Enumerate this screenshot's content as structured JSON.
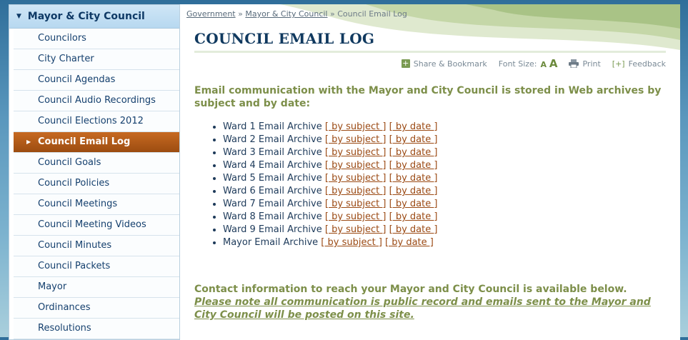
{
  "sidebar": {
    "heading": "Mayor & City Council",
    "items": [
      {
        "label": "Councilors"
      },
      {
        "label": "City Charter"
      },
      {
        "label": "Council Agendas"
      },
      {
        "label": "Council Audio Recordings"
      },
      {
        "label": "Council Elections 2012"
      },
      {
        "label": "Council Email Log",
        "active": true
      },
      {
        "label": "Council Goals"
      },
      {
        "label": "Council Policies"
      },
      {
        "label": "Council Meetings"
      },
      {
        "label": "Council Meeting Videos"
      },
      {
        "label": "Council Minutes"
      },
      {
        "label": "Council Packets"
      },
      {
        "label": "Mayor"
      },
      {
        "label": "Ordinances"
      },
      {
        "label": "Resolutions"
      }
    ]
  },
  "breadcrumb": {
    "items": [
      "Government",
      "Mayor & City Council"
    ],
    "separator": "»",
    "current": "Council Email Log"
  },
  "page": {
    "title": "COUNCIL EMAIL LOG"
  },
  "tools": {
    "share": "Share & Bookmark",
    "font_size": "Font Size:",
    "font_small": "A",
    "font_large": "A",
    "print": "Print",
    "feedback_icon": "[+]",
    "feedback": "Feedback"
  },
  "intro": "Email communication with the Mayor and City Council is stored in Web archives by subject and by date:",
  "archives": {
    "by_subject": "[ by subject ]",
    "by_date": "[ by date ]",
    "items": [
      "Ward 1 Email Archive",
      "Ward 2 Email Archive",
      "Ward 3 Email Archive",
      "Ward 4 Email Archive",
      "Ward 5 Email Archive",
      "Ward 6 Email Archive",
      "Ward 7 Email Archive",
      "Ward 8 Email Archive",
      "Ward 9 Email Archive",
      "Mayor Email Archive"
    ]
  },
  "contact": {
    "text": "Contact information to reach your Mayor and City Council is available below.",
    "notice": "Please note all communication is public record and emails sent to the Mayor and City Council will be posted on this site."
  },
  "colors": {
    "nav_text": "#15406e",
    "active_item": "#b25c18",
    "title": "#10395f",
    "intro_green": "#7d8f4a",
    "link_brown": "#9b4a14"
  }
}
